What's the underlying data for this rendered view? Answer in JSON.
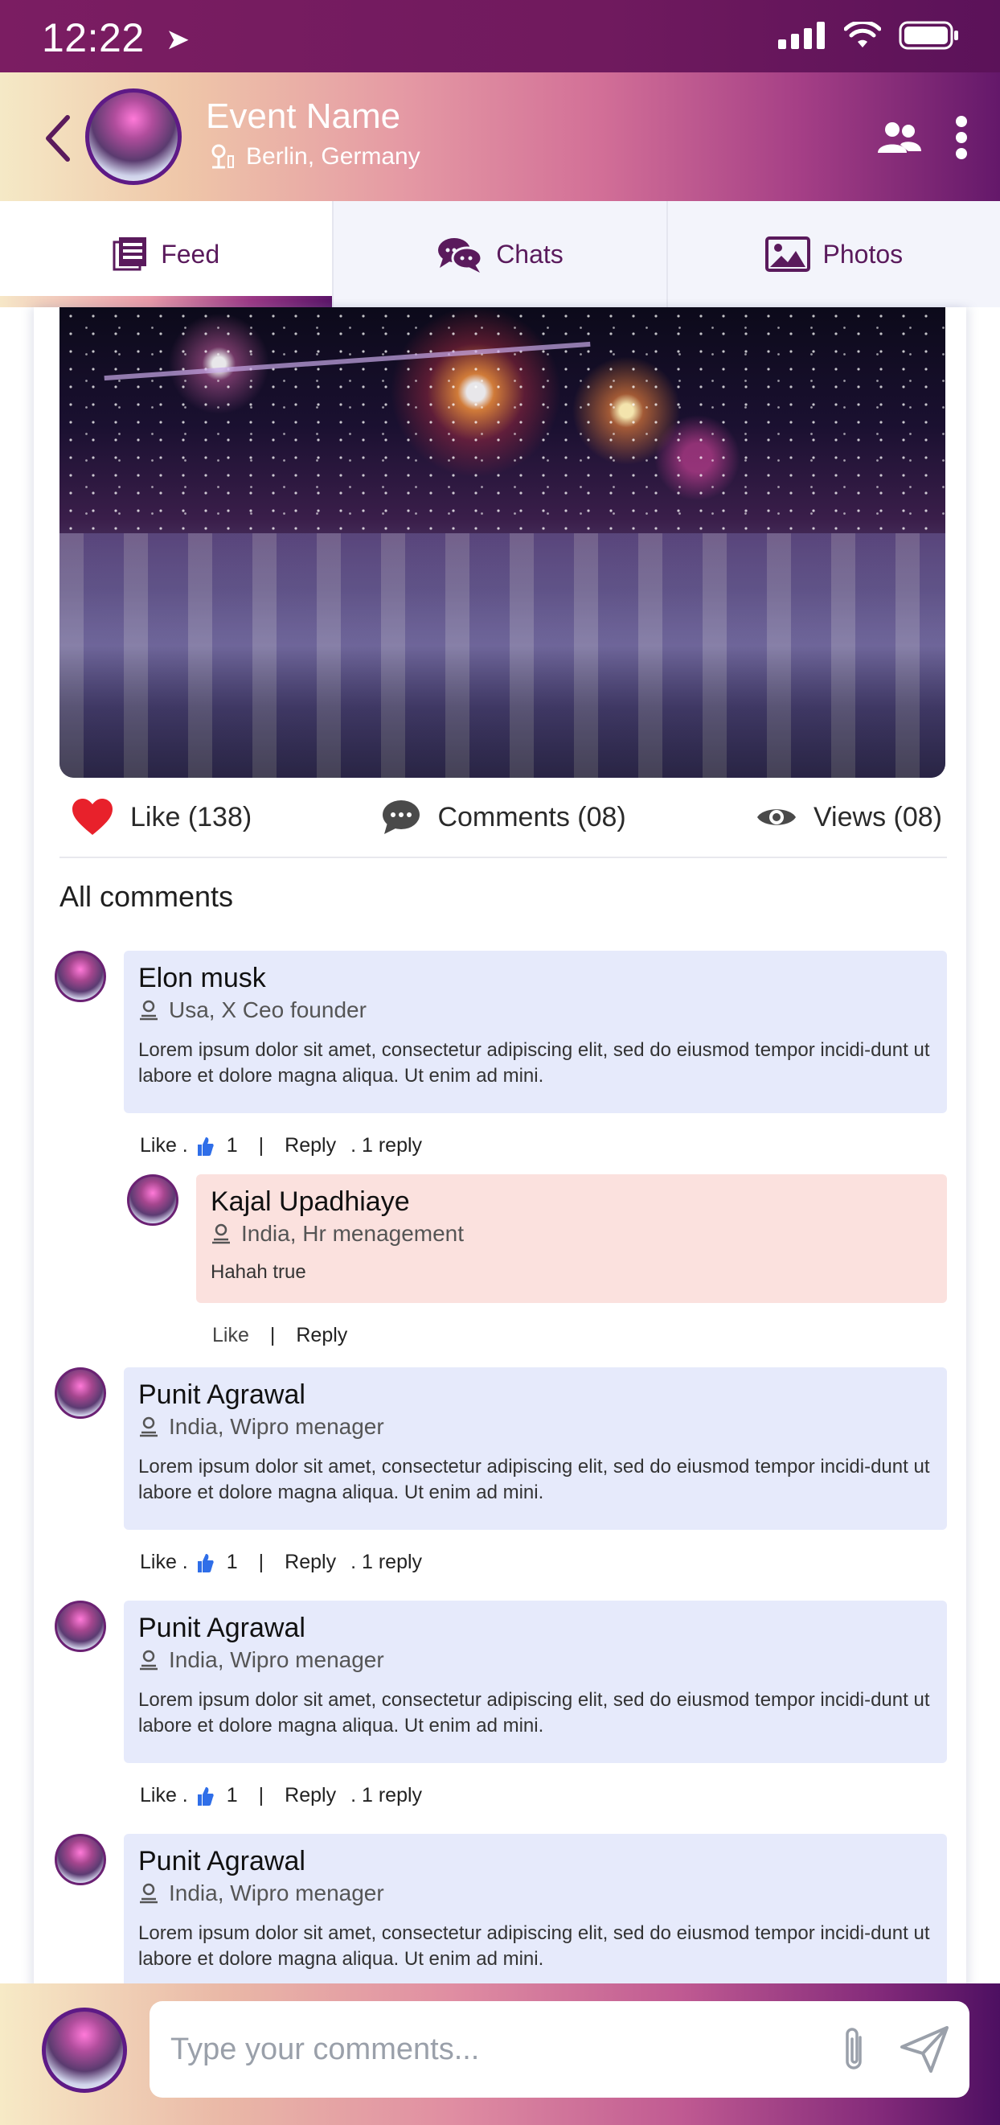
{
  "status_bar": {
    "time": "12:22"
  },
  "header": {
    "title": "Event Name",
    "location": "Berlin, Germany"
  },
  "tabs": [
    {
      "label": "Feed",
      "icon": "feed-icon",
      "active": true
    },
    {
      "label": "Chats",
      "icon": "chats-icon",
      "active": false
    },
    {
      "label": "Photos",
      "icon": "photos-icon",
      "active": false
    }
  ],
  "post": {
    "likes_label": "Like (138)",
    "comments_label": "Comments (08)",
    "views_label": "Views (08)"
  },
  "comments_title": "All comments",
  "comments": [
    {
      "name": "Elon musk",
      "role": "Usa, X Ceo founder",
      "text": "Lorem ipsum dolor sit amet, consectetur adipiscing elit, sed do eiusmod tempor incidi-dunt ut labore et dolore magna aliqua. Ut enim ad mini.",
      "like_label": "Like .",
      "like_count": "1",
      "reply_label": "Reply",
      "reply_count": ". 1  reply"
    },
    {
      "name": "Kajal Upadhiaye",
      "role": "India, Hr menagement",
      "text": "Hahah true",
      "like_label": "Like",
      "reply_label": "Reply"
    },
    {
      "name": "Punit Agrawal",
      "role": "India, Wipro menager",
      "text": "Lorem ipsum dolor sit amet, consectetur adipiscing elit, sed do eiusmod tempor incidi-dunt ut labore et dolore magna aliqua. Ut enim ad mini.",
      "like_label": "Like .",
      "like_count": "1",
      "reply_label": "Reply",
      "reply_count": ". 1  reply"
    },
    {
      "name": "Punit Agrawal",
      "role": "India, Wipro menager",
      "text": "Lorem ipsum dolor sit amet, consectetur adipiscing elit, sed do eiusmod tempor incidi-dunt ut labore et dolore magna aliqua. Ut enim ad mini.",
      "like_label": "Like .",
      "like_count": "1",
      "reply_label": "Reply",
      "reply_count": ". 1  reply"
    },
    {
      "name": "Punit Agrawal",
      "role": "India, Wipro menager",
      "text": "Lorem ipsum dolor sit amet, consectetur adipiscing elit, sed do eiusmod tempor incidi-dunt ut labore et dolore magna aliqua. Ut enim ad mini."
    }
  ],
  "composer": {
    "placeholder": "Type your comments..."
  },
  "colors": {
    "brand_purple": "#6a1a6c",
    "comment_blue": "#e6eafb",
    "reply_pink": "#fbe1de",
    "like_red": "#e8212b",
    "thumb_blue": "#2f6ee8"
  }
}
